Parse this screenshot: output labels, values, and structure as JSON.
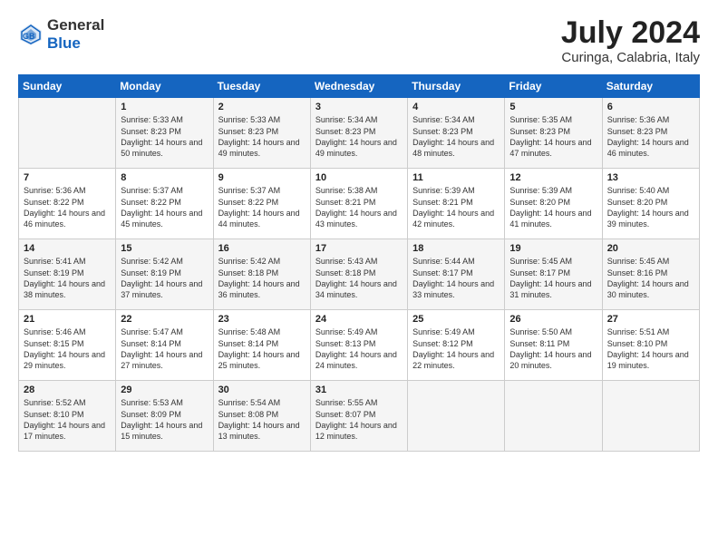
{
  "header": {
    "logo_general": "General",
    "logo_blue": "Blue",
    "month_title": "July 2024",
    "subtitle": "Curinga, Calabria, Italy"
  },
  "days_of_week": [
    "Sunday",
    "Monday",
    "Tuesday",
    "Wednesday",
    "Thursday",
    "Friday",
    "Saturday"
  ],
  "weeks": [
    [
      {
        "day": "",
        "sunrise": "",
        "sunset": "",
        "daylight": ""
      },
      {
        "day": "1",
        "sunrise": "Sunrise: 5:33 AM",
        "sunset": "Sunset: 8:23 PM",
        "daylight": "Daylight: 14 hours and 50 minutes."
      },
      {
        "day": "2",
        "sunrise": "Sunrise: 5:33 AM",
        "sunset": "Sunset: 8:23 PM",
        "daylight": "Daylight: 14 hours and 49 minutes."
      },
      {
        "day": "3",
        "sunrise": "Sunrise: 5:34 AM",
        "sunset": "Sunset: 8:23 PM",
        "daylight": "Daylight: 14 hours and 49 minutes."
      },
      {
        "day": "4",
        "sunrise": "Sunrise: 5:34 AM",
        "sunset": "Sunset: 8:23 PM",
        "daylight": "Daylight: 14 hours and 48 minutes."
      },
      {
        "day": "5",
        "sunrise": "Sunrise: 5:35 AM",
        "sunset": "Sunset: 8:23 PM",
        "daylight": "Daylight: 14 hours and 47 minutes."
      },
      {
        "day": "6",
        "sunrise": "Sunrise: 5:36 AM",
        "sunset": "Sunset: 8:23 PM",
        "daylight": "Daylight: 14 hours and 46 minutes."
      }
    ],
    [
      {
        "day": "7",
        "sunrise": "Sunrise: 5:36 AM",
        "sunset": "Sunset: 8:22 PM",
        "daylight": "Daylight: 14 hours and 46 minutes."
      },
      {
        "day": "8",
        "sunrise": "Sunrise: 5:37 AM",
        "sunset": "Sunset: 8:22 PM",
        "daylight": "Daylight: 14 hours and 45 minutes."
      },
      {
        "day": "9",
        "sunrise": "Sunrise: 5:37 AM",
        "sunset": "Sunset: 8:22 PM",
        "daylight": "Daylight: 14 hours and 44 minutes."
      },
      {
        "day": "10",
        "sunrise": "Sunrise: 5:38 AM",
        "sunset": "Sunset: 8:21 PM",
        "daylight": "Daylight: 14 hours and 43 minutes."
      },
      {
        "day": "11",
        "sunrise": "Sunrise: 5:39 AM",
        "sunset": "Sunset: 8:21 PM",
        "daylight": "Daylight: 14 hours and 42 minutes."
      },
      {
        "day": "12",
        "sunrise": "Sunrise: 5:39 AM",
        "sunset": "Sunset: 8:20 PM",
        "daylight": "Daylight: 14 hours and 41 minutes."
      },
      {
        "day": "13",
        "sunrise": "Sunrise: 5:40 AM",
        "sunset": "Sunset: 8:20 PM",
        "daylight": "Daylight: 14 hours and 39 minutes."
      }
    ],
    [
      {
        "day": "14",
        "sunrise": "Sunrise: 5:41 AM",
        "sunset": "Sunset: 8:19 PM",
        "daylight": "Daylight: 14 hours and 38 minutes."
      },
      {
        "day": "15",
        "sunrise": "Sunrise: 5:42 AM",
        "sunset": "Sunset: 8:19 PM",
        "daylight": "Daylight: 14 hours and 37 minutes."
      },
      {
        "day": "16",
        "sunrise": "Sunrise: 5:42 AM",
        "sunset": "Sunset: 8:18 PM",
        "daylight": "Daylight: 14 hours and 36 minutes."
      },
      {
        "day": "17",
        "sunrise": "Sunrise: 5:43 AM",
        "sunset": "Sunset: 8:18 PM",
        "daylight": "Daylight: 14 hours and 34 minutes."
      },
      {
        "day": "18",
        "sunrise": "Sunrise: 5:44 AM",
        "sunset": "Sunset: 8:17 PM",
        "daylight": "Daylight: 14 hours and 33 minutes."
      },
      {
        "day": "19",
        "sunrise": "Sunrise: 5:45 AM",
        "sunset": "Sunset: 8:17 PM",
        "daylight": "Daylight: 14 hours and 31 minutes."
      },
      {
        "day": "20",
        "sunrise": "Sunrise: 5:45 AM",
        "sunset": "Sunset: 8:16 PM",
        "daylight": "Daylight: 14 hours and 30 minutes."
      }
    ],
    [
      {
        "day": "21",
        "sunrise": "Sunrise: 5:46 AM",
        "sunset": "Sunset: 8:15 PM",
        "daylight": "Daylight: 14 hours and 29 minutes."
      },
      {
        "day": "22",
        "sunrise": "Sunrise: 5:47 AM",
        "sunset": "Sunset: 8:14 PM",
        "daylight": "Daylight: 14 hours and 27 minutes."
      },
      {
        "day": "23",
        "sunrise": "Sunrise: 5:48 AM",
        "sunset": "Sunset: 8:14 PM",
        "daylight": "Daylight: 14 hours and 25 minutes."
      },
      {
        "day": "24",
        "sunrise": "Sunrise: 5:49 AM",
        "sunset": "Sunset: 8:13 PM",
        "daylight": "Daylight: 14 hours and 24 minutes."
      },
      {
        "day": "25",
        "sunrise": "Sunrise: 5:49 AM",
        "sunset": "Sunset: 8:12 PM",
        "daylight": "Daylight: 14 hours and 22 minutes."
      },
      {
        "day": "26",
        "sunrise": "Sunrise: 5:50 AM",
        "sunset": "Sunset: 8:11 PM",
        "daylight": "Daylight: 14 hours and 20 minutes."
      },
      {
        "day": "27",
        "sunrise": "Sunrise: 5:51 AM",
        "sunset": "Sunset: 8:10 PM",
        "daylight": "Daylight: 14 hours and 19 minutes."
      }
    ],
    [
      {
        "day": "28",
        "sunrise": "Sunrise: 5:52 AM",
        "sunset": "Sunset: 8:10 PM",
        "daylight": "Daylight: 14 hours and 17 minutes."
      },
      {
        "day": "29",
        "sunrise": "Sunrise: 5:53 AM",
        "sunset": "Sunset: 8:09 PM",
        "daylight": "Daylight: 14 hours and 15 minutes."
      },
      {
        "day": "30",
        "sunrise": "Sunrise: 5:54 AM",
        "sunset": "Sunset: 8:08 PM",
        "daylight": "Daylight: 14 hours and 13 minutes."
      },
      {
        "day": "31",
        "sunrise": "Sunrise: 5:55 AM",
        "sunset": "Sunset: 8:07 PM",
        "daylight": "Daylight: 14 hours and 12 minutes."
      },
      {
        "day": "",
        "sunrise": "",
        "sunset": "",
        "daylight": ""
      },
      {
        "day": "",
        "sunrise": "",
        "sunset": "",
        "daylight": ""
      },
      {
        "day": "",
        "sunrise": "",
        "sunset": "",
        "daylight": ""
      }
    ]
  ]
}
